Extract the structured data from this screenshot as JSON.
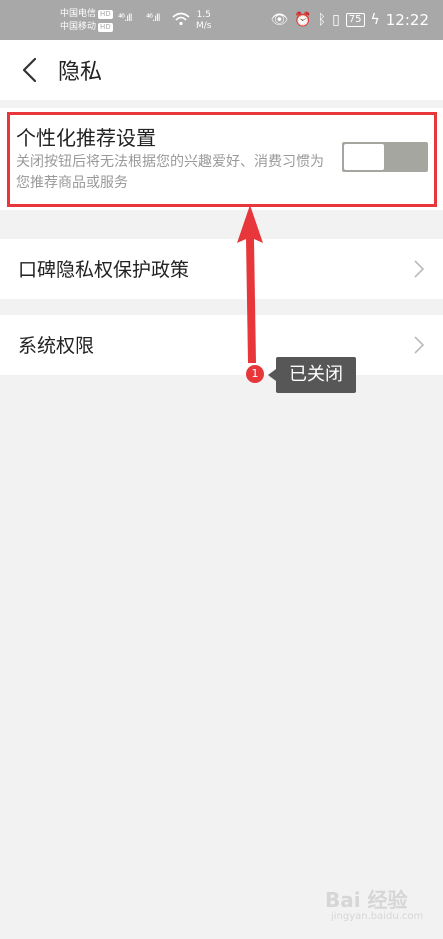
{
  "status_bar": {
    "carrier1": "中国电信",
    "carrier2": "中国移动",
    "hd": "HD",
    "signal_a": "⁴⁶.ıll",
    "signal_b": "⁴⁶.ıll",
    "speed_value": "1.5",
    "speed_unit": "M/s",
    "battery": "75",
    "time": "12:22"
  },
  "header": {
    "title": "隐私"
  },
  "recommendation": {
    "title": "个性化推荐设置",
    "description": "关闭按钮后将无法根据您的兴趣爱好、消费习惯为您推荐商品或服务",
    "toggle_on": false
  },
  "rows": [
    {
      "label": "口碑隐私权保护政策"
    },
    {
      "label": "系统权限"
    }
  ],
  "annotation": {
    "number": "1",
    "text": "已关闭"
  },
  "watermark": {
    "brand": "Bai 经验",
    "sub": "jingyan.baidu.com"
  },
  "colors": {
    "accent_red": "#e8373b",
    "statusbar": "#a8a8a8",
    "toggle_off": "#a6a6a0"
  }
}
